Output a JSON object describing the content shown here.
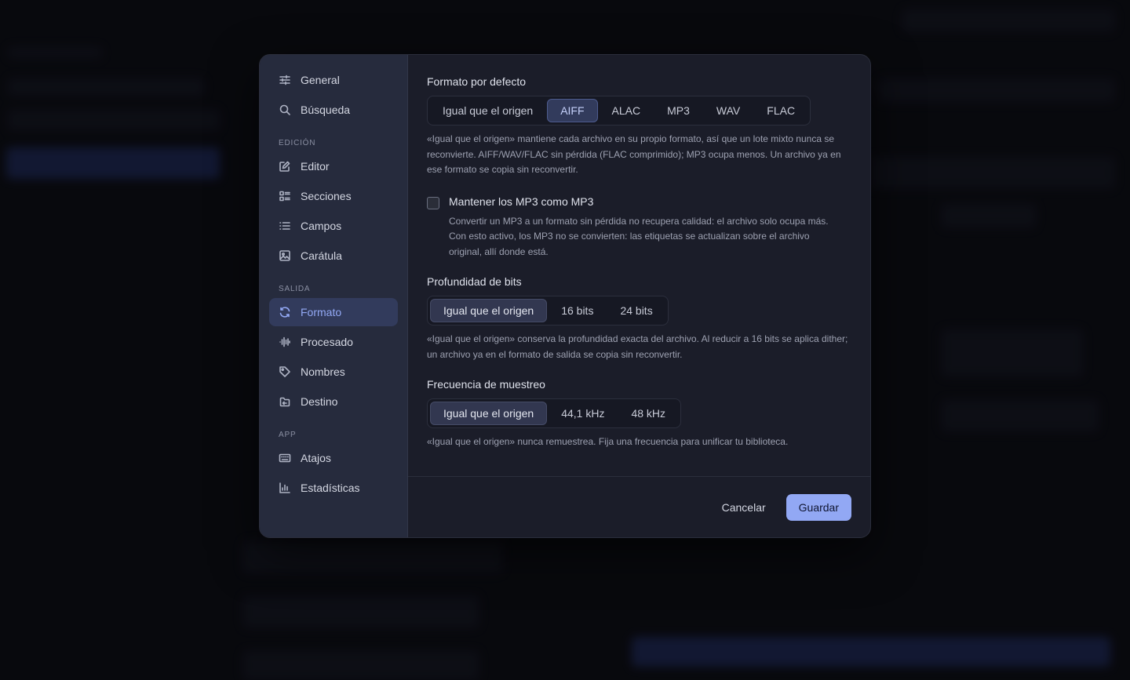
{
  "sidebar": {
    "items_top": [
      {
        "label": "General",
        "icon": "sliders-icon"
      },
      {
        "label": "Búsqueda",
        "icon": "search-icon"
      }
    ],
    "sections": [
      {
        "label": "EDICIÓN",
        "items": [
          {
            "label": "Editor",
            "icon": "edit-icon"
          },
          {
            "label": "Secciones",
            "icon": "sections-icon"
          },
          {
            "label": "Campos",
            "icon": "list-icon"
          },
          {
            "label": "Carátula",
            "icon": "image-icon"
          }
        ]
      },
      {
        "label": "SALIDA",
        "items": [
          {
            "label": "Formato",
            "icon": "refresh-icon",
            "active": true
          },
          {
            "label": "Procesado",
            "icon": "waveform-icon"
          },
          {
            "label": "Nombres",
            "icon": "tag-icon"
          },
          {
            "label": "Destino",
            "icon": "destination-icon"
          }
        ]
      },
      {
        "label": "APP",
        "items": [
          {
            "label": "Atajos",
            "icon": "keyboard-icon"
          },
          {
            "label": "Estadísticas",
            "icon": "bar-chart-icon"
          }
        ]
      }
    ],
    "accent_color": "#93a9f5"
  },
  "format": {
    "title": "Formato por defecto",
    "options": [
      "Igual que el origen",
      "AIFF",
      "ALAC",
      "MP3",
      "WAV",
      "FLAC"
    ],
    "selected": "AIFF",
    "help": "«Igual que el origen» mantiene cada archivo en su propio formato, así que un lote mixto nunca se reconvierte. AIFF/WAV/FLAC sin pérdida (FLAC comprimido); MP3 ocupa menos. Un archivo ya en ese formato se copia sin reconvertir."
  },
  "keep_mp3": {
    "label": "Mantener los MP3 como MP3",
    "checked": false,
    "help": "Convertir un MP3 a un formato sin pérdida no recupera calidad: el archivo solo ocupa más. Con esto activo, los MP3 no se convierten: las etiquetas se actualizan sobre el archivo original, allí donde está."
  },
  "bit_depth": {
    "title": "Profundidad de bits",
    "options": [
      "Igual que el origen",
      "16 bits",
      "24 bits"
    ],
    "selected": "Igual que el origen",
    "help": "«Igual que el origen» conserva la profundidad exacta del archivo. Al reducir a 16 bits se aplica dither; un archivo ya en el formato de salida se copia sin reconvertir."
  },
  "sample_rate": {
    "title": "Frecuencia de muestreo",
    "options": [
      "Igual que el origen",
      "44,1 kHz",
      "48 kHz"
    ],
    "selected": "Igual que el origen",
    "help": "«Igual que el origen» nunca remuestrea. Fija una frecuencia para unificar tu biblioteca."
  },
  "footer": {
    "cancel_label": "Cancelar",
    "save_label": "Guardar",
    "save_color": "#92a8f4"
  }
}
